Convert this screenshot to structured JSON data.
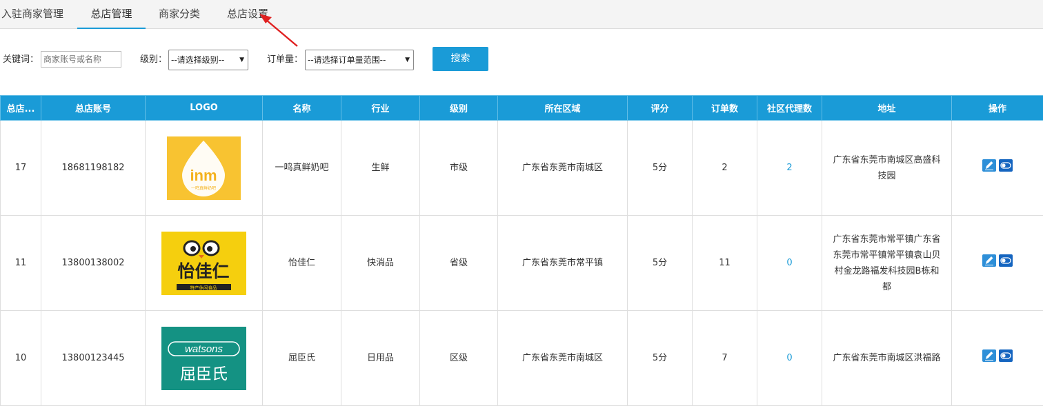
{
  "tabs": [
    {
      "label": "入驻商家管理"
    },
    {
      "label": "总店管理"
    },
    {
      "label": "商家分类"
    },
    {
      "label": "总店设置"
    }
  ],
  "filters": {
    "keyword_label": "关键词：",
    "keyword_placeholder": "商家账号或名称",
    "level_label": "级别：",
    "level_value": "--请选择级别--",
    "orders_label": "订单量：",
    "orders_value": "--请选择订单量范围--",
    "search_button": "搜索"
  },
  "table": {
    "headers": [
      "总店...",
      "总店账号",
      "LOGO",
      "名称",
      "行业",
      "级别",
      "所在区域",
      "评分",
      "订单数",
      "社区代理数",
      "地址",
      "操作"
    ],
    "rows": [
      {
        "id": "17",
        "account": "18681198182",
        "logo_text": "inm",
        "logo_sub": "一鸣真鲜奶吧",
        "name": "一鸣真鲜奶吧",
        "industry": "生鲜",
        "level": "市级",
        "region": "广东省东莞市南城区",
        "score": "5分",
        "orders": "2",
        "agents": "2",
        "address": "广东省东莞市南城区高盛科技园"
      },
      {
        "id": "11",
        "account": "13800138002",
        "logo_text": "怡佳仁",
        "logo_sub": "特产休闲食品",
        "name": "怡佳仁",
        "industry": "快消品",
        "level": "省级",
        "region": "广东省东莞市常平镇",
        "score": "5分",
        "orders": "11",
        "agents": "0",
        "address": "广东省东莞市常平镇广东省东莞市常平镇常平镇袁山贝村金龙路福发科技园B栋和都"
      },
      {
        "id": "10",
        "account": "13800123445",
        "logo_text": "watsons",
        "logo_sub": "屈臣氏",
        "name": "屈臣氏",
        "industry": "日用品",
        "level": "区级",
        "region": "广东省东莞市南城区",
        "score": "5分",
        "orders": "7",
        "agents": "0",
        "address": "广东省东莞市南城区洪福路"
      }
    ]
  },
  "colors": {
    "accent": "#1a9bd7",
    "inm_yellow": "#f8c331",
    "yjr_yellow": "#f5cf0e",
    "watsons_green": "#149283",
    "arrow_red": "#e02020"
  }
}
